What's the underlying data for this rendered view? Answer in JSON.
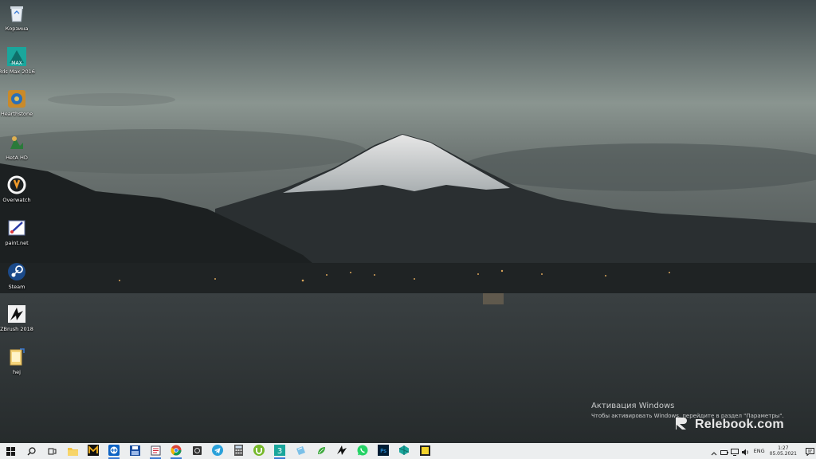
{
  "desktop": {
    "icons": [
      {
        "label": "Корзина",
        "icon": "recycle-bin-icon"
      },
      {
        "label": "3ds Max 2016",
        "icon": "3ds-max-icon"
      },
      {
        "label": "Hearthstone",
        "icon": "hearthstone-icon"
      },
      {
        "label": "HetA HD",
        "icon": "heta-hd-icon"
      },
      {
        "label": "Overwatch",
        "icon": "overwatch-icon"
      },
      {
        "label": "paint.net",
        "icon": "paint-net-icon"
      },
      {
        "label": "Steam",
        "icon": "steam-icon"
      },
      {
        "label": "ZBrush 2018",
        "icon": "zbrush-icon"
      },
      {
        "label": "hej",
        "icon": "folder-icon"
      }
    ]
  },
  "activation": {
    "title": "Активация Windows",
    "subtitle": "Чтобы активировать Windows, перейдите в раздел \"Параметры\"."
  },
  "watermark": {
    "text": "Relebook.com"
  },
  "taskbar": {
    "pinned": [
      "windows-start-icon",
      "search-icon",
      "task-view-icon",
      "file-explorer-icon",
      "maya-icon",
      "teamviewer-icon",
      "save-disk-icon",
      "notes-app-icon",
      "chrome-icon",
      "disk-utility-icon",
      "telegram-icon",
      "calculator-icon",
      "utorrent-icon",
      "3ds-max-taskbar-icon",
      "notepad-icon",
      "green-app-icon",
      "zbrush-taskbar-icon",
      "whatsapp-icon",
      "photoshop-icon",
      "unity-icon",
      "sticky-notes-icon"
    ]
  },
  "tray": {
    "language": "ENG",
    "time": "1:27",
    "date": "05.05.2021"
  },
  "colors": {
    "taskbar": "#eceeef",
    "sky_top": "#3f4a4d",
    "lake": "#2d3234",
    "accent": "#3a7bd5"
  }
}
